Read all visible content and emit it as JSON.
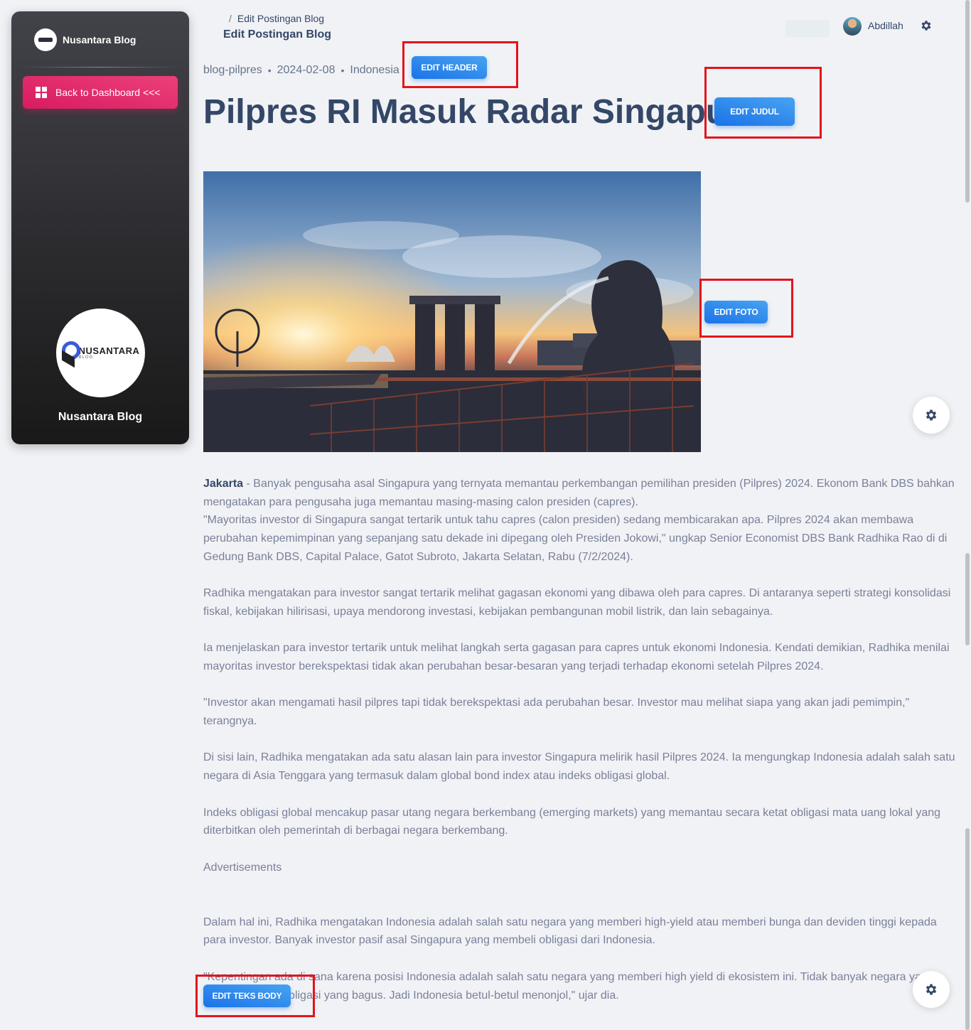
{
  "sidebar": {
    "brand_name": "Nusantara Blog",
    "back_button_label": "Back to Dashboard <<<",
    "footer_logo_title": "NUSANTARA",
    "footer_logo_subtitle": "BLOG",
    "footer_name": "Nusantara Blog"
  },
  "header": {
    "breadcrumb_separator": "/",
    "breadcrumb_current": "Edit Postingan Blog",
    "page_title": "Edit Postingan Blog",
    "user_name": "Abdillah"
  },
  "post": {
    "slug": "blog-pilpres",
    "date": "2024-02-08",
    "category": "Indonesia",
    "title": "Pilpres RI Masuk Radar Singapura",
    "body_lead_bold": "Jakarta",
    "body_lead_rest": " - Banyak pengusaha asal Singapura yang ternyata memantau perkembangan pemilihan presiden (Pilpres) 2024. Ekonom Bank DBS bahkan mengatakan para pengusaha juga memantau masing-masing calon presiden (capres).",
    "paragraphs": [
      "\"Mayoritas investor di Singapura sangat tertarik untuk tahu capres (calon presiden) sedang membicarakan apa. Pilpres 2024 akan membawa perubahan kepemimpinan yang sepanjang satu dekade ini dipegang oleh Presiden Jokowi,\" ungkap Senior Economist DBS Bank Radhika Rao di di Gedung Bank DBS, Capital Palace, Gatot Subroto, Jakarta Selatan, Rabu (7/2/2024).",
      "Radhika mengatakan para investor sangat tertarik melihat gagasan ekonomi yang dibawa oleh para capres. Di antaranya seperti strategi konsolidasi fiskal, kebijakan hilirisasi, upaya mendorong investasi, kebijakan pembangunan mobil listrik, dan lain sebagainya.",
      "Ia menjelaskan para investor tertarik untuk melihat langkah serta gagasan para capres untuk ekonomi Indonesia. Kendati demikian, Radhika menilai mayoritas investor berekspektasi tidak akan perubahan besar-besaran yang terjadi terhadap ekonomi setelah Pilpres 2024.",
      "\"Investor akan mengamati hasil pilpres tapi tidak berekspektasi ada perubahan besar. Investor mau melihat siapa yang akan jadi pemimpin,\" terangnya.",
      "Di sisi lain, Radhika mengatakan ada satu alasan lain para investor Singapura melirik hasil Pilpres 2024. Ia mengungkap Indonesia adalah salah satu negara di Asia Tenggara yang termasuk dalam global bond index atau indeks obligasi global.",
      "Indeks obligasi global mencakup pasar utang negara berkembang (emerging markets) yang memantau secara ketat obligasi mata uang lokal yang diterbitkan oleh pemerintah di berbagai negara berkembang.",
      "Advertisements",
      "Dalam hal ini, Radhika mengatakan Indonesia adalah salah satu negara yang memberi high-yield atau memberi bunga dan deviden tinggi kepada para investor. Banyak investor pasif asal Singapura yang membeli obligasi dari Indonesia.",
      "\"Kepentingan ada di sana karena posisi Indonesia adalah salah satu negara yang memberi high yield di ekosistem ini. Tidak banyak negara yang membeli return obligasi yang bagus. Jadi Indonesia betul-betul menonjol,\" ujar dia."
    ]
  },
  "buttons": {
    "edit_header": "EDIT HEADER",
    "edit_judul": "EDIT JUDUL",
    "edit_foto": "EDIT FOTO",
    "edit_body": "EDIT TEKS BODY"
  },
  "colors": {
    "accent_pink": "#e91e63",
    "accent_blue": "#1a73e8",
    "highlight_red": "#e3141c",
    "heading": "#344767"
  },
  "icons": {
    "dashboard": "dashboard-grid-icon",
    "settings": "gear-icon"
  }
}
